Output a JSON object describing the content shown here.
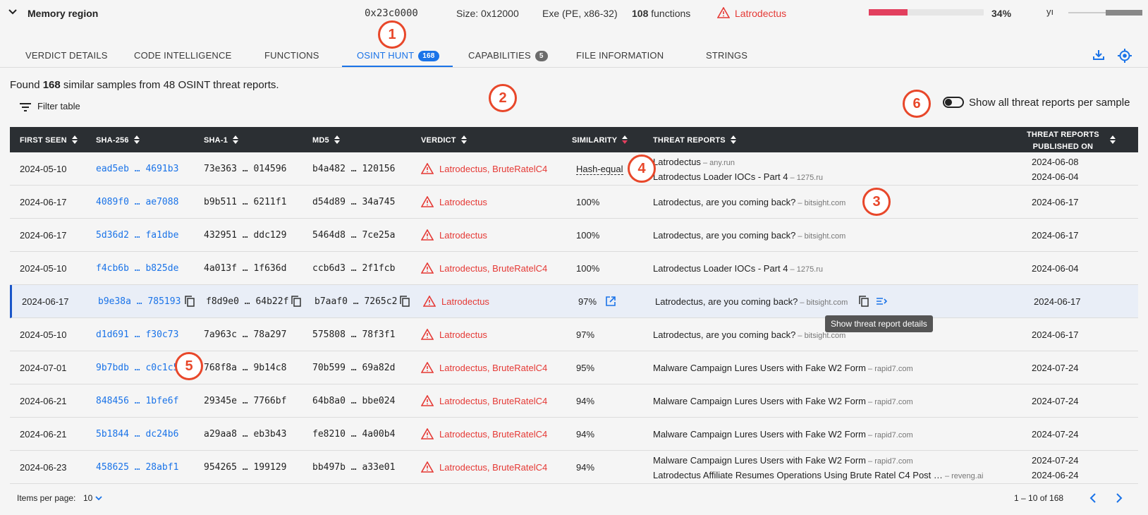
{
  "top": {
    "title": "Memory region",
    "address": "0x23c0000",
    "size": "Size:  0x12000",
    "exe": "Exe (PE, x86-32)",
    "functions_count": "108",
    "functions_label": " functions",
    "malware": "Latrodectus",
    "progress_percent": 34,
    "percent_label": "34%",
    "extra_glyph": "yı"
  },
  "markers": [
    "1",
    "2",
    "3",
    "4",
    "5",
    "6"
  ],
  "tabs": [
    {
      "label": "VERDICT DETAILS"
    },
    {
      "label": "CODE INTELLIGENCE"
    },
    {
      "label": "FUNCTIONS"
    },
    {
      "label": "OSINT HUNT",
      "badge": "168"
    },
    {
      "label": "CAPABILITIES",
      "badge": "5"
    },
    {
      "label": "FILE INFORMATION"
    },
    {
      "label": "STRINGS"
    }
  ],
  "summary": {
    "pre": "Found ",
    "count": "168",
    "post": " similar samples from 48 OSINT threat reports."
  },
  "filter_label": "Filter table",
  "toggle_label": "Show all threat reports per sample",
  "columns": {
    "first_seen": "FIRST SEEN",
    "sha256": "SHA-256",
    "sha1": "SHA-1",
    "md5": "MD5",
    "verdict": "VERDICT",
    "similarity": "SIMILARITY",
    "threat_reports": "THREAT REPORTS",
    "published_1": "THREAT REPORTS",
    "published_2": "PUBLISHED ON"
  },
  "rows": [
    {
      "date": "2024-05-10",
      "sha256": "ead5eb … 4691b3",
      "sha1": "73e363 … 014596",
      "md5": "b4a482 … 120156",
      "verdict": "Latrodectus, BruteRatelC4",
      "similarity": "Hash-equal",
      "reports": [
        {
          "title": "Latrodectus",
          "src": " – any.run"
        },
        {
          "title": "Latrodectus Loader IOCs - Part 4",
          "src": " – 1275.ru"
        }
      ],
      "published": [
        "2024-06-08",
        "2024-06-04"
      ]
    },
    {
      "date": "2024-06-17",
      "sha256": "4089f0 … ae7088",
      "sha1": "b9b511 … 6211f1",
      "md5": "d54d89 … 34a745",
      "verdict": "Latrodectus",
      "similarity": "100%",
      "reports": [
        {
          "title": "Latrodectus, are you coming back?",
          "src": " – bitsight.com"
        }
      ],
      "published": [
        "2024-06-17"
      ]
    },
    {
      "date": "2024-06-17",
      "sha256": "5d36d2 … fa1dbe",
      "sha1": "432951 … ddc129",
      "md5": "5464d8 … 7ce25a",
      "verdict": "Latrodectus",
      "similarity": "100%",
      "reports": [
        {
          "title": "Latrodectus, are you coming back?",
          "src": " – bitsight.com"
        }
      ],
      "published": [
        "2024-06-17"
      ]
    },
    {
      "date": "2024-05-10",
      "sha256": "f4cb6b … b825de",
      "sha1": "4a013f … 1f636d",
      "md5": "ccb6d3 … 2f1fcb",
      "verdict": "Latrodectus, BruteRatelC4",
      "similarity": "100%",
      "reports": [
        {
          "title": "Latrodectus Loader IOCs - Part 4",
          "src": " – 1275.ru"
        }
      ],
      "published": [
        "2024-06-04"
      ]
    },
    {
      "date": "2024-06-17",
      "sha256": "b9e38a … 785193",
      "sha1": "f8d9e0 … 64b22f",
      "md5": "b7aaf0 … 7265c2",
      "verdict": "Latrodectus",
      "similarity": "97%",
      "reports": [
        {
          "title": "Latrodectus, are you coming back?",
          "src": " – bitsight.com"
        }
      ],
      "published": [
        "2024-06-17"
      ]
    },
    {
      "date": "2024-05-10",
      "sha256": "d1d691 … f30c73",
      "sha1": "7a963c … 78a297",
      "md5": "575808 … 78f3f1",
      "verdict": "Latrodectus",
      "similarity": "97%",
      "reports": [
        {
          "title": "Latrodectus, are you coming back?",
          "src": " – bitsight.com"
        }
      ],
      "published": [
        "2024-06-17"
      ]
    },
    {
      "date": "2024-07-01",
      "sha256": "9b7bdb … c0c1c5",
      "sha1": "768f8a … 9b14c8",
      "md5": "70b599 … 69a82d",
      "verdict": "Latrodectus, BruteRatelC4",
      "similarity": "95%",
      "reports": [
        {
          "title": "Malware Campaign Lures Users with Fake W2 Form",
          "src": " – rapid7.com"
        }
      ],
      "published": [
        "2024-07-24"
      ]
    },
    {
      "date": "2024-06-21",
      "sha256": "848456 … 1bfe6f",
      "sha1": "29345e … 7766bf",
      "md5": "64b8a0 … bbe024",
      "verdict": "Latrodectus, BruteRatelC4",
      "similarity": "94%",
      "reports": [
        {
          "title": "Malware Campaign Lures Users with Fake W2 Form",
          "src": " – rapid7.com"
        }
      ],
      "published": [
        "2024-07-24"
      ]
    },
    {
      "date": "2024-06-21",
      "sha256": "5b1844 … dc24b6",
      "sha1": "a29aa8 … eb3b43",
      "md5": "fe8210 … 4a00b4",
      "verdict": "Latrodectus, BruteRatelC4",
      "similarity": "94%",
      "reports": [
        {
          "title": "Malware Campaign Lures Users with Fake W2 Form",
          "src": " – rapid7.com"
        }
      ],
      "published": [
        "2024-07-24"
      ]
    },
    {
      "date": "2024-06-23",
      "sha256": "458625 … 28abf1",
      "sha1": "954265 … 199129",
      "md5": "bb497b … a33e01",
      "verdict": "Latrodectus, BruteRatelC4",
      "similarity": "94%",
      "reports": [
        {
          "title": "Malware Campaign Lures Users with Fake W2 Form",
          "src": " – rapid7.com"
        },
        {
          "title": "Latrodectus Affiliate Resumes Operations Using Brute Ratel C4 Post …",
          "src": " – reveng.ai"
        }
      ],
      "published": [
        "2024-07-24",
        "2024-06-24"
      ]
    }
  ],
  "tooltip": "Show threat report details",
  "footer": {
    "items_per_page": "Items per page:",
    "ipp_value": "10",
    "range": "1 – 10 of 168"
  },
  "colors": {
    "accent": "#1a73e8",
    "danger": "#e53935",
    "marker": "#e8472a",
    "header": "#2b2f33"
  }
}
